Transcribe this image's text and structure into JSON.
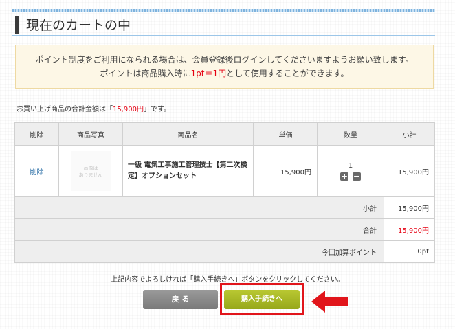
{
  "page": {
    "title": "現在のカートの中"
  },
  "notice": {
    "line1": "ポイント制度をご利用になられる場合は、会員登録後ログインしてくださいますようお願い致します。",
    "line2_pre": "ポイントは商品購入時に",
    "line2_highlight": "1pt＝1円",
    "line2_post": "として使用することができます。"
  },
  "total_summary": {
    "pre": "お買い上げ商品の合計金額は「",
    "amount": "15,900円",
    "post": "」です。"
  },
  "table": {
    "headers": [
      "削除",
      "商品写真",
      "商品名",
      "単価",
      "数量",
      "小計"
    ],
    "items": [
      {
        "delete_label": "削除",
        "photo_placeholder_line1": "画像は",
        "photo_placeholder_line2": "ありません",
        "name": "一級 電気工事施工管理技士【第二次検定】オプションセット",
        "unit_price": "15,900円",
        "quantity": "1",
        "plus": "+",
        "minus": "−",
        "subtotal": "15,900円"
      }
    ],
    "summary": {
      "subtotal_label": "小計",
      "subtotal_value": "15,900円",
      "total_label": "合計",
      "total_value": "15,900円",
      "points_label": "今回加算ポイント",
      "points_value": "0pt"
    }
  },
  "footer": {
    "note": "上記内容でよろしければ「購入手続きへ」ボタンをクリックしてください。",
    "back_button": "戻 る",
    "purchase_button": "購入手続きへ"
  },
  "colors": {
    "accent_red": "#e60012",
    "purchase_green": "#a8b822",
    "highlight_box": "#e1151b"
  }
}
